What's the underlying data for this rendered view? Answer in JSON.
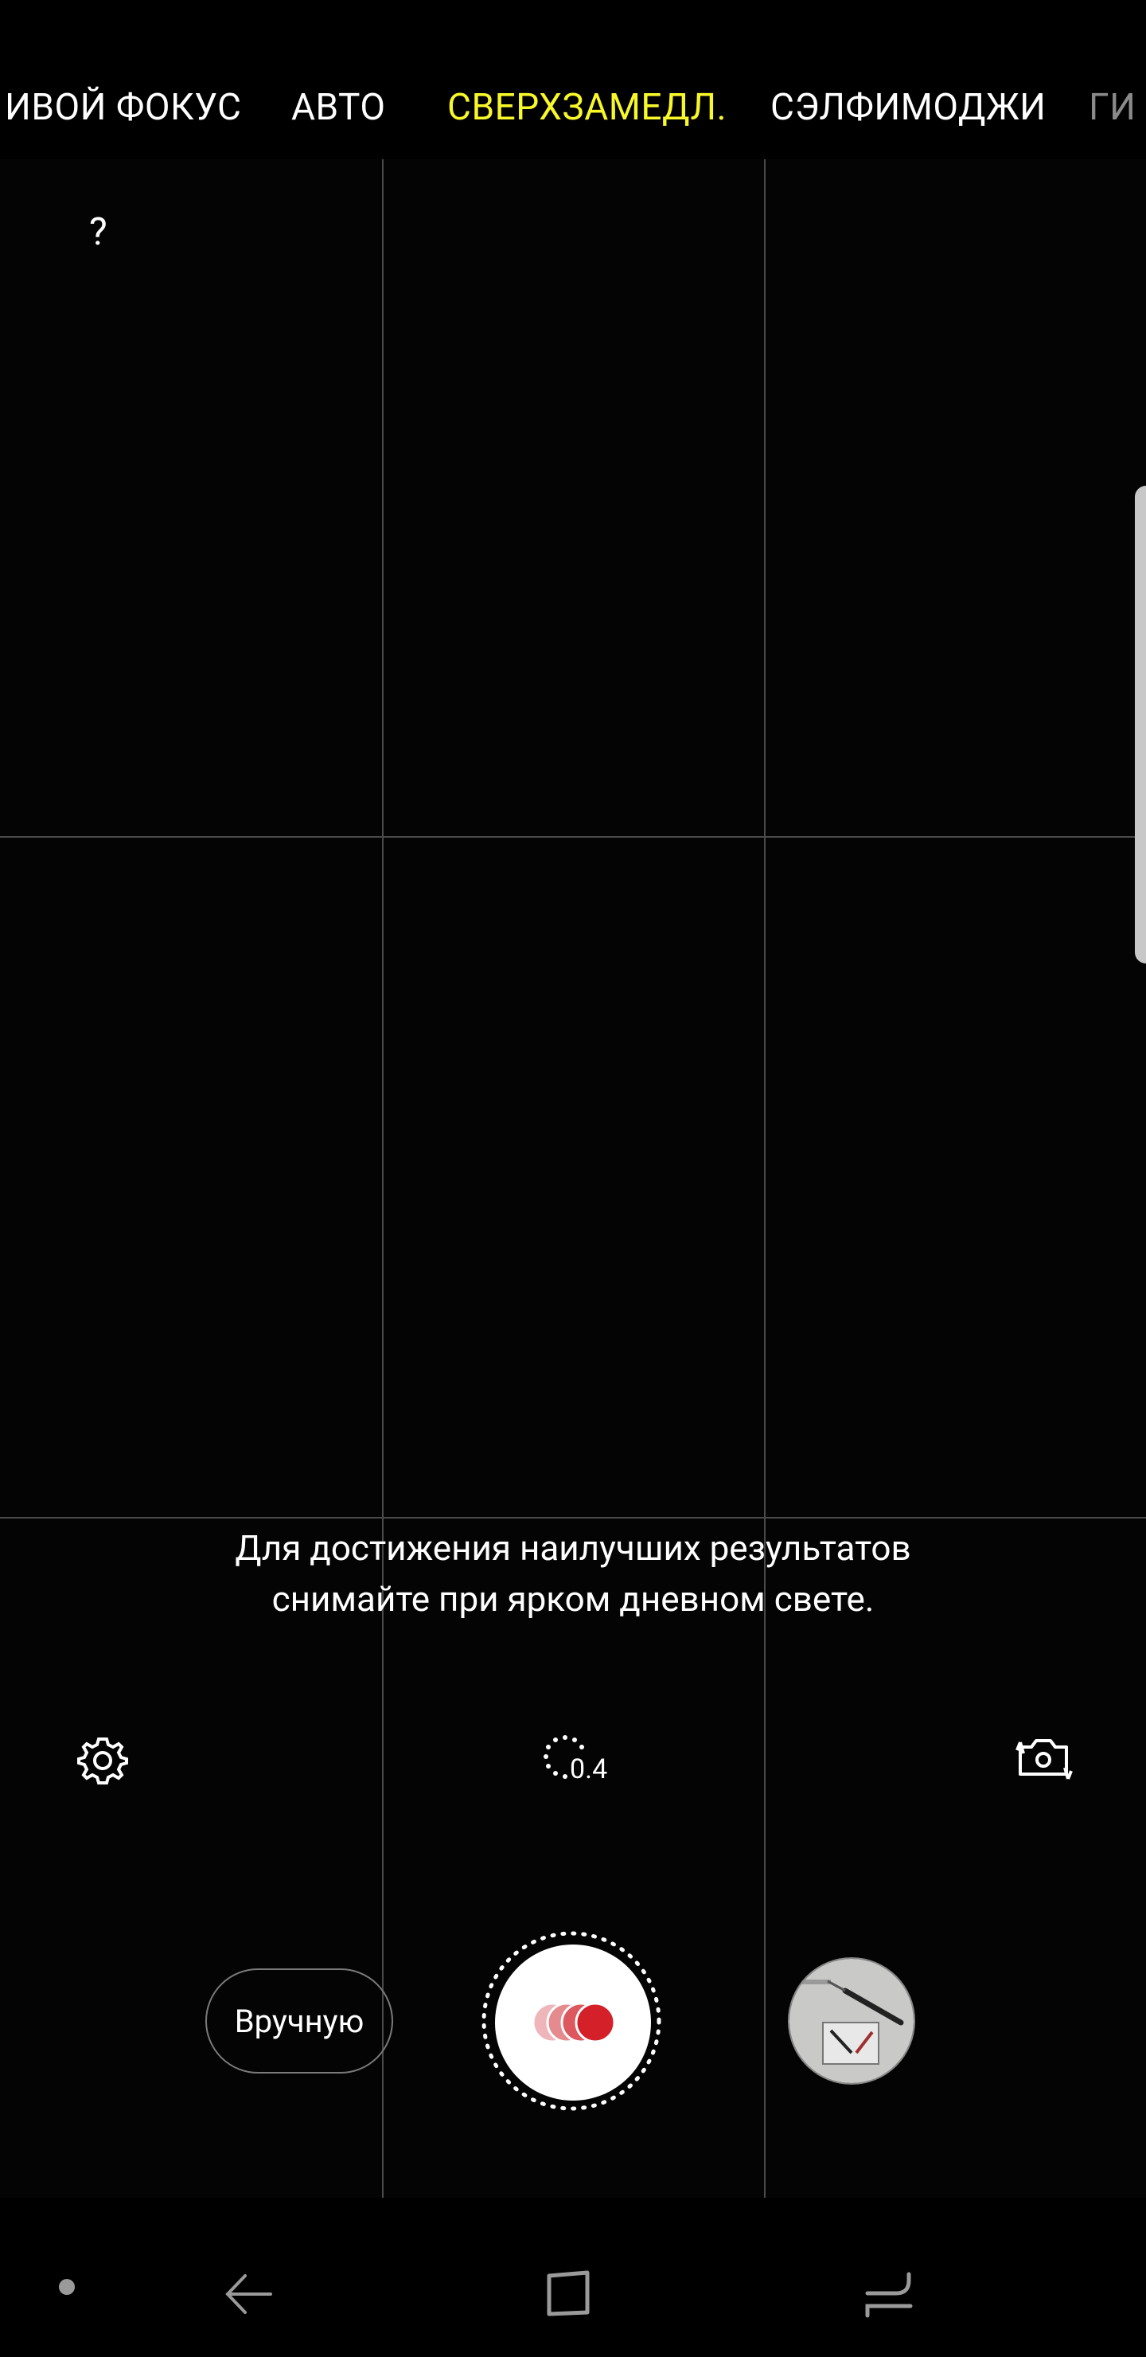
{
  "modes": [
    {
      "label": "ИВОЙ ФОКУС",
      "state": "normal"
    },
    {
      "label": "АВТО",
      "state": "normal"
    },
    {
      "label": "СВЕРХЗАМЕДЛ.",
      "state": "active"
    },
    {
      "label": "СЭЛФИМОДЖИ",
      "state": "normal"
    },
    {
      "label": "ГИ",
      "state": "faded"
    }
  ],
  "help": {
    "label": "?"
  },
  "tip": {
    "line1": "Для достижения наилучших результатов",
    "line2": "снимайте при ярком дневном свете."
  },
  "controls": {
    "timer_value": "0.4",
    "manual_label": "Вручную"
  },
  "colors": {
    "active_mode": "#f7f72a",
    "record_red": "#d32029"
  },
  "icons": {
    "settings": "gear-icon",
    "timer": "motion-detect-timer-icon",
    "switch_camera": "switch-camera-icon",
    "record": "super-slow-mo-record-icon",
    "nav_dot": "nav-dot-icon",
    "nav_back": "back-arrow-icon",
    "nav_home": "home-square-icon",
    "nav_recents": "recents-icon"
  }
}
